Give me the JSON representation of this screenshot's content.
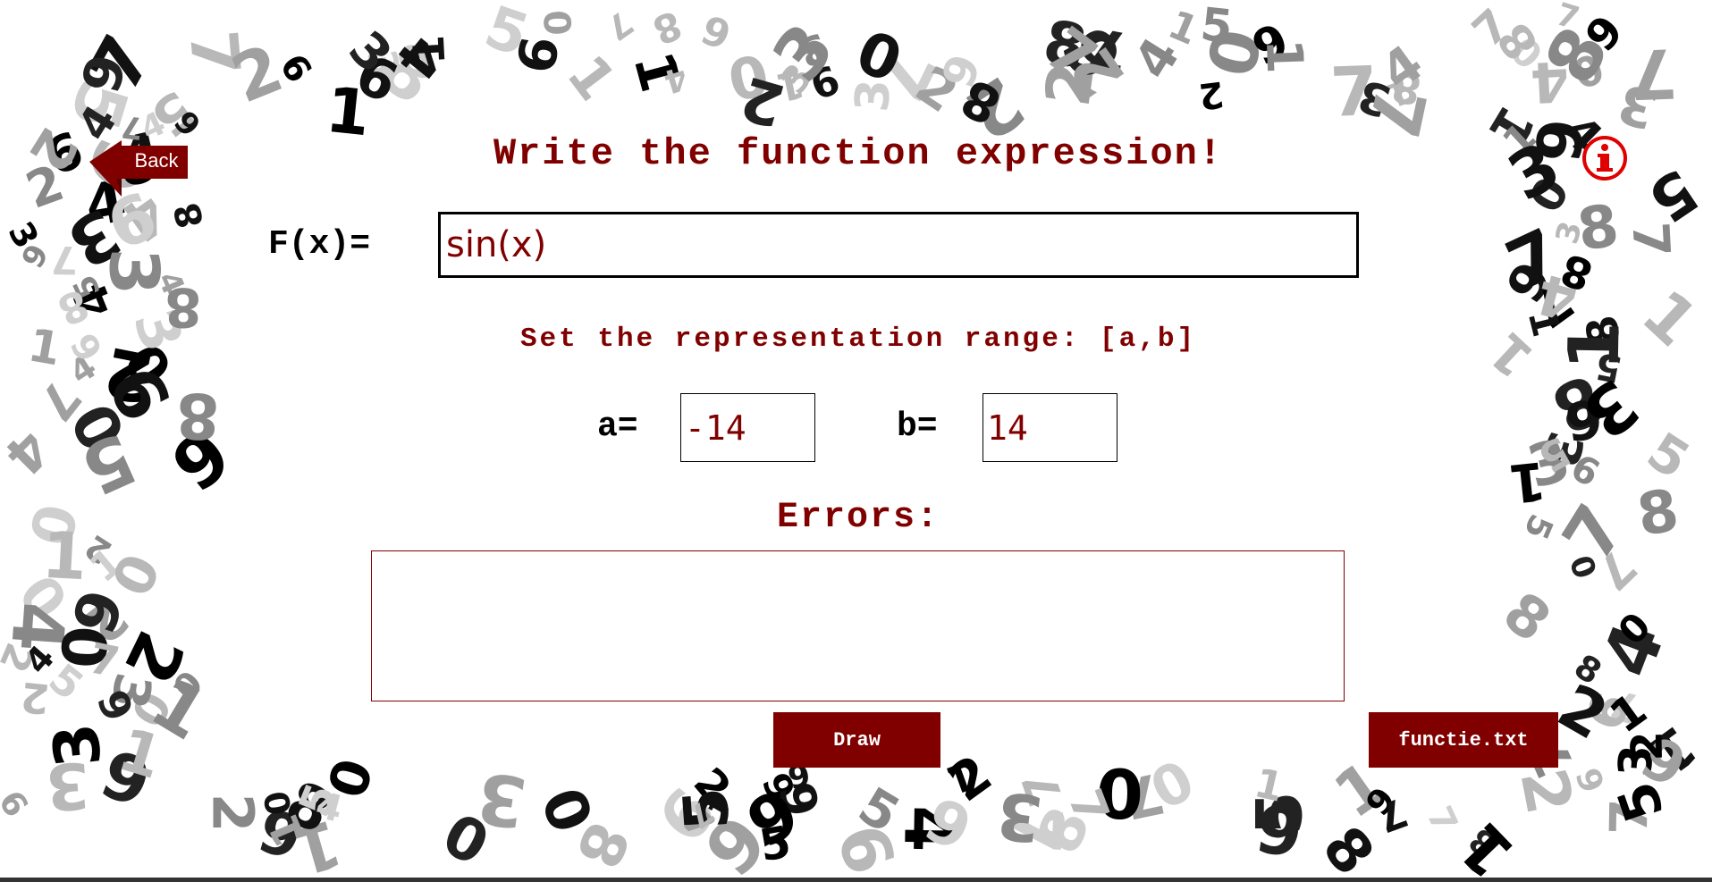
{
  "background": {
    "digits": [
      "3",
      "9",
      "2",
      "6",
      "4",
      "8",
      "1",
      "5",
      "0",
      "7",
      "9",
      "6",
      "4",
      "2",
      "5",
      "8",
      "0",
      "3",
      "1",
      "7",
      "5",
      "9",
      "6",
      "0",
      "4",
      "2",
      "8",
      "7",
      "1",
      "3"
    ]
  },
  "back_button": {
    "label": "Back",
    "icon": "left-arrow-tag",
    "color": "#800000"
  },
  "title": "Write the function expression!",
  "info_button": {
    "icon": "info-icon",
    "color": "#e00000"
  },
  "function_field": {
    "label": "F(x)=",
    "value": "sin(x)"
  },
  "range": {
    "title": "Set the representation range: [a,b]",
    "a_label": "a=",
    "a_value": "-14",
    "b_label": "b=",
    "b_value": "14"
  },
  "errors": {
    "title": "Errors:",
    "value": ""
  },
  "draw_button": {
    "label": "Draw"
  },
  "file_button": {
    "label": "functie.txt"
  },
  "colors": {
    "accent": "#800000",
    "text": "#000000",
    "background": "#ffffff",
    "info": "#e00000"
  }
}
